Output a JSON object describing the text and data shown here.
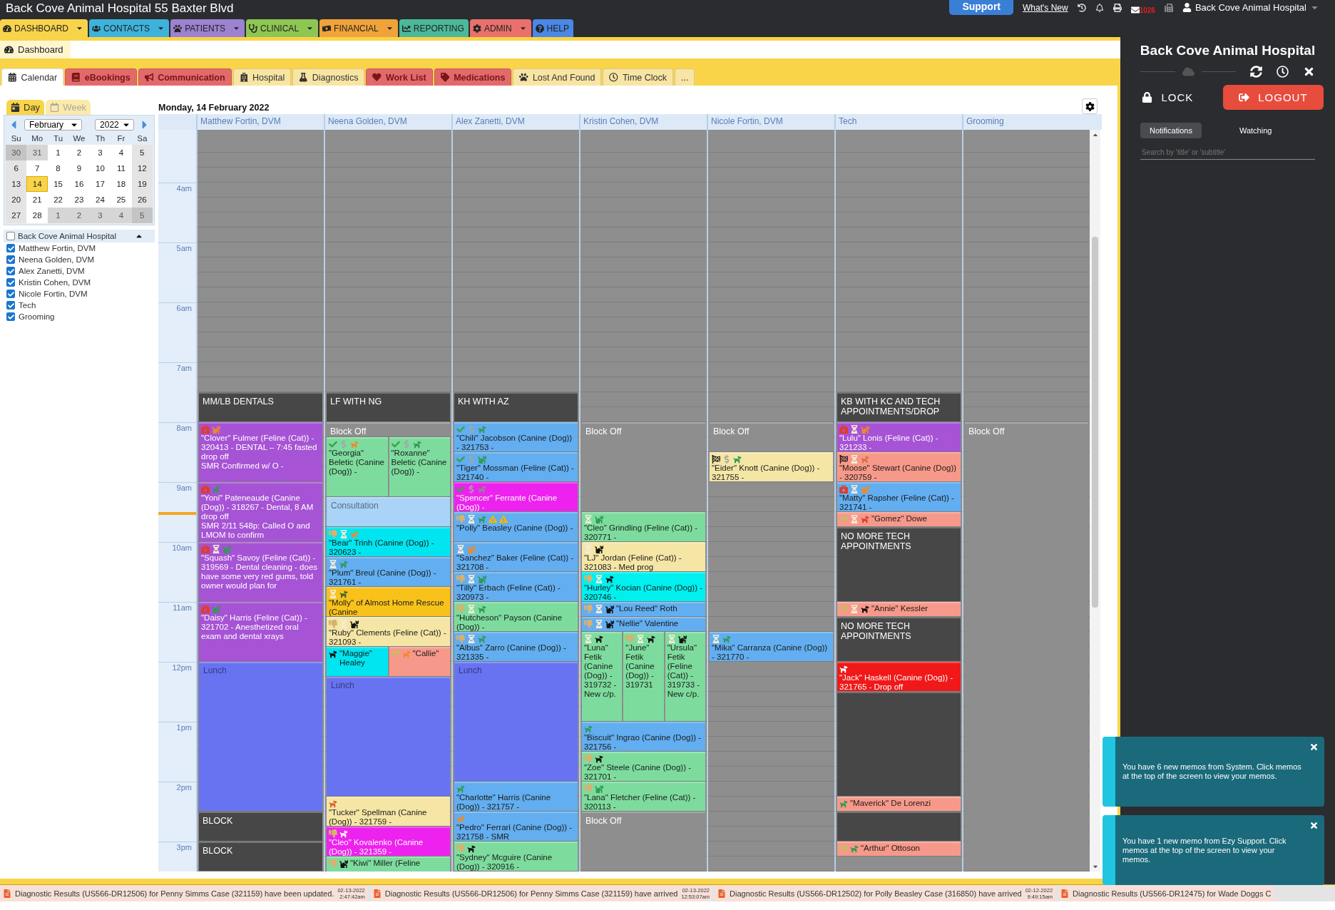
{
  "header": {
    "title": "Back Cove Animal Hospital 55 Baxter Blvd",
    "support": "Support",
    "whats_new": "What's New",
    "mail_count": "1026",
    "user": "Back Cove Animal Hospital"
  },
  "nav": [
    {
      "label": "DASHBOARD",
      "color": "#f8d44c",
      "menu": true
    },
    {
      "label": "CONTACTS",
      "color": "#3db3dc",
      "menu": true
    },
    {
      "label": "PATIENTS",
      "color": "#9c82d0",
      "menu": true
    },
    {
      "label": "CLINICAL",
      "color": "#8ec653",
      "menu": true
    },
    {
      "label": "FINANCIAL",
      "color": "#f0a33a",
      "menu": true
    },
    {
      "label": "REPORTING",
      "color": "#4cb89a",
      "menu": false
    },
    {
      "label": "ADMIN",
      "color": "#e9706c",
      "menu": true
    },
    {
      "label": "HELP",
      "color": "#4a87e6",
      "menu": false
    }
  ],
  "page_tab": "Dashboard",
  "tabs": [
    {
      "label": "Calendar",
      "selected": true
    },
    {
      "label": "eBookings",
      "color": "#e36a6a",
      "selected": false
    },
    {
      "label": "Communication",
      "color": "#e36a6a",
      "selected": false
    },
    {
      "label": "Hospital",
      "color": "#f8e5a3",
      "selected": false
    },
    {
      "label": "Diagnostics",
      "color": "#f8e5a3",
      "selected": false
    },
    {
      "label": "Work List",
      "color": "#e36a6a",
      "selected": false
    },
    {
      "label": "Medications",
      "color": "#e36a6a",
      "selected": false
    },
    {
      "label": "Lost And Found",
      "color": "#f8e5a3",
      "selected": false
    },
    {
      "label": "Time Clock",
      "color": "#f8e5a3",
      "selected": false
    },
    {
      "label": "...",
      "color": "#f8e5a3",
      "selected": false
    }
  ],
  "view_tabs": [
    {
      "label": "Day",
      "selected": true
    },
    {
      "label": "Week",
      "selected": false
    }
  ],
  "mini_calendar": {
    "month": "February",
    "year": "2022",
    "weekdays": [
      "Su",
      "Mo",
      "Tu",
      "We",
      "Th",
      "Fr",
      "Sa"
    ],
    "weeks": [
      [
        {
          "day": "30",
          "other_month": true,
          "selected": false
        },
        {
          "day": "31",
          "other_month": true,
          "selected": false
        },
        {
          "day": "1",
          "other_month": false,
          "selected": false
        },
        {
          "day": "2",
          "other_month": false,
          "selected": false
        },
        {
          "day": "3",
          "other_month": false,
          "selected": false
        },
        {
          "day": "4",
          "other_month": false,
          "selected": false
        },
        {
          "day": "5",
          "other_month": false,
          "selected": false
        }
      ],
      [
        {
          "day": "6",
          "other_month": false,
          "selected": false
        },
        {
          "day": "7",
          "other_month": false,
          "selected": false
        },
        {
          "day": "8",
          "other_month": false,
          "selected": false
        },
        {
          "day": "9",
          "other_month": false,
          "selected": false
        },
        {
          "day": "10",
          "other_month": false,
          "selected": false
        },
        {
          "day": "11",
          "other_month": false,
          "selected": false
        },
        {
          "day": "12",
          "other_month": false,
          "selected": false
        }
      ],
      [
        {
          "day": "13",
          "other_month": false,
          "selected": false
        },
        {
          "day": "14",
          "other_month": false,
          "selected": true
        },
        {
          "day": "15",
          "other_month": false,
          "selected": false
        },
        {
          "day": "16",
          "other_month": false,
          "selected": false
        },
        {
          "day": "17",
          "other_month": false,
          "selected": false
        },
        {
          "day": "18",
          "other_month": false,
          "selected": false
        },
        {
          "day": "19",
          "other_month": false,
          "selected": false
        }
      ],
      [
        {
          "day": "20",
          "other_month": false,
          "selected": false
        },
        {
          "day": "21",
          "other_month": false,
          "selected": false
        },
        {
          "day": "22",
          "other_month": false,
          "selected": false
        },
        {
          "day": "23",
          "other_month": false,
          "selected": false
        },
        {
          "day": "24",
          "other_month": false,
          "selected": false
        },
        {
          "day": "25",
          "other_month": false,
          "selected": false
        },
        {
          "day": "26",
          "other_month": false,
          "selected": false
        }
      ],
      [
        {
          "day": "27",
          "other_month": false,
          "selected": false
        },
        {
          "day": "28",
          "other_month": false,
          "selected": false
        },
        {
          "day": "1",
          "other_month": true,
          "selected": false
        },
        {
          "day": "2",
          "other_month": true,
          "selected": false
        },
        {
          "day": "3",
          "other_month": true,
          "selected": false
        },
        {
          "day": "4",
          "other_month": true,
          "selected": false
        },
        {
          "day": "5",
          "other_month": true,
          "selected": false
        }
      ]
    ]
  },
  "resources": {
    "group": {
      "label": "Back Cove Animal Hospital",
      "checked": false,
      "expanded": true
    },
    "items": [
      {
        "label": "Matthew Fortin, DVM",
        "checked": true
      },
      {
        "label": "Neena Golden, DVM",
        "checked": true
      },
      {
        "label": "Alex Zanetti, DVM",
        "checked": true
      },
      {
        "label": "Kristin Cohen, DVM",
        "checked": true
      },
      {
        "label": "Nicole Fortin, DVM",
        "checked": true
      },
      {
        "label": "Tech",
        "checked": true
      },
      {
        "label": "Grooming",
        "checked": true
      }
    ]
  },
  "calendar": {
    "date": "Monday, 14 February 2022",
    "hours": [
      "4am",
      "5am",
      "6am",
      "7am",
      "8am",
      "9am",
      "10am",
      "11am",
      "12pm",
      "1pm",
      "2pm",
      "3pm"
    ],
    "columns": [
      {
        "name": "Matthew Fortin, DVM",
        "events": [
          {
            "kind": "block",
            "text": "MM/LB DENTALS"
          },
          {
            "kind": "appointment",
            "color": "#a653d5",
            "icons": [
              {
                "kind": "medical"
              },
              {
                "kind": "cat",
                "color": "#f0882a"
              }
            ],
            "text": "\"Clover\" Fulmer (Feline (Cat)) - 320413 - DENTAL – 7:45 fasted drop off\nSMR Confirmed w/ O -"
          },
          {
            "kind": "appointment",
            "color": "#a653d5",
            "icons": [
              {
                "kind": "medical"
              },
              {
                "kind": "dog",
                "color": "#2f9a55"
              }
            ],
            "text": "\"Yoni\" Pateneaude (Canine (Dog)) - 318267 - Dental, 8 AM drop off\nSMR 2/11 548p: Called O and LMOM to confirm"
          },
          {
            "kind": "appointment",
            "color": "#a653d5",
            "icons": [
              {
                "kind": "medical"
              },
              {
                "kind": "hourglass"
              },
              {
                "kind": "cat",
                "color": "#2f9a55"
              }
            ],
            "text": "\"Squash\" Savoy (Feline (Cat)) - 319569 - Dental cleaning - does have some very red gums, told owner would plan for"
          },
          {
            "kind": "appointment",
            "color": "#a653d5",
            "icons": [
              {
                "kind": "medical"
              },
              {
                "kind": "cat",
                "color": "#2f9a55"
              }
            ],
            "text": "\"Daisy\" Harris (Feline (Cat)) - 321702 - Anesthetized oral exam and dental xrays"
          },
          {
            "kind": "reserved",
            "color": "#6873f2",
            "text": "Lunch"
          },
          {
            "kind": "block",
            "text": "BLOCK"
          },
          {
            "kind": "block",
            "text": "BLOCK"
          }
        ]
      },
      {
        "name": "Neena Golden, DVM",
        "events": [
          {
            "kind": "block",
            "text": "LF WITH NG"
          },
          {
            "kind": "blockoff",
            "text": "Block Off"
          },
          {
            "kind": "split",
            "parts": [
              {
                "color": "#7ddc9d",
                "icons": [
                  {
                    "kind": "check"
                  },
                  {
                    "kind": "dollar"
                  },
                  {
                    "kind": "dog",
                    "color": "#f0882a"
                  }
                ],
                "text": "\"Georgia\" Beletic (Canine (Dog)) -"
              },
              {
                "color": "#7ddc9d",
                "icons": [
                  {
                    "kind": "check"
                  },
                  {
                    "kind": "dollar"
                  },
                  {
                    "kind": "dog",
                    "color": "#2f9a55"
                  }
                ],
                "text": "\"Roxanne\" Beletic (Canine (Dog)) -"
              }
            ]
          },
          {
            "kind": "reserved",
            "color": "#a9d3f7",
            "text": "Consultation"
          },
          {
            "kind": "appointment",
            "color": "#00e5f0",
            "icons": [
              {
                "kind": "thumb"
              },
              {
                "kind": "hourglass"
              },
              {
                "kind": "dog",
                "color": "#f0882a"
              }
            ],
            "text": "\"Bear\" Trinh (Canine (Dog)) - 320623 -"
          },
          {
            "kind": "appointment",
            "color": "#62aef0",
            "icons": [
              {
                "kind": "hourglass"
              },
              {
                "kind": "dog",
                "color": "#2f9a55"
              }
            ],
            "text": "\"Plum\" Breul (Canine (Dog)) - 321761 -"
          },
          {
            "kind": "appointment",
            "color": "#f9c21a",
            "icons": [
              {
                "kind": "hourglass"
              },
              {
                "kind": "dog",
                "color": "#3d6b2a"
              }
            ],
            "text": "\"Molly\" of Almost Home Rescue (Canine"
          },
          {
            "kind": "appointment",
            "color": "#f5e6a6",
            "icons": [
              {
                "kind": "thumb"
              },
              {
                "kind": "hourglass"
              },
              {
                "kind": "cat",
                "color": "#111111"
              }
            ],
            "text": "\"Ruby\" Clements (Feline (Cat)) - 321093 -"
          },
          {
            "kind": "split",
            "parts": [
              {
                "color": "#00e5f0",
                "icons": [
                  {
                    "kind": "dog",
                    "color": "#111111"
                  }
                ],
                "text": "\"Maggie\" Healey"
              },
              {
                "color": "#f7998a",
                "icons": [
                  {
                    "kind": "thumb"
                  },
                  {
                    "kind": "dog",
                    "color": "#f0882a"
                  }
                ],
                "text": "\"Callie\""
              }
            ]
          },
          {
            "kind": "reserved",
            "color": "#6873f2",
            "text": "Lunch"
          },
          {
            "kind": "appointment",
            "color": "#f5e6a6",
            "icons": [
              {
                "kind": "dog",
                "color": "#e0602b"
              }
            ],
            "text": "\"Tucker\" Spellman (Canine (Dog)) - 321759 -"
          },
          {
            "kind": "appointment",
            "color": "#ee22ee",
            "icons": [
              {
                "kind": "thumb"
              },
              {
                "kind": "dog",
                "color": "#ffffff"
              }
            ],
            "text": "\"Cleo\" Kovalenko (Canine (Dog)) - 321359 -"
          },
          {
            "kind": "appointment",
            "color": "#7ddc9d",
            "icons": [
              {
                "kind": "thumb"
              },
              {
                "kind": "cat",
                "color": "#111111"
              }
            ],
            "text": "\"Kiwi\" Miller (Feline"
          }
        ]
      },
      {
        "name": "Alex Zanetti, DVM",
        "events": [
          {
            "kind": "block",
            "text": "KH WITH AZ"
          },
          {
            "kind": "appointment",
            "color": "#62aef0",
            "icons": [
              {
                "kind": "check"
              },
              {
                "kind": "dollar"
              },
              {
                "kind": "dog",
                "color": "#2f9a55"
              }
            ],
            "text": "\"Chili\" Jacobson (Canine (Dog)) - 321753 -"
          },
          {
            "kind": "appointment",
            "color": "#62aef0",
            "icons": [
              {
                "kind": "check"
              },
              {
                "kind": "dollar"
              },
              {
                "kind": "cat",
                "color": "#2f9a55"
              }
            ],
            "text": "\"Tiger\" Mossman (Feline (Cat)) - 321740 -"
          },
          {
            "kind": "appointment",
            "color": "#ee22ee",
            "icons": [
              {
                "kind": "check"
              },
              {
                "kind": "dollar"
              },
              {
                "kind": "dog",
                "color": "#8a8a8a"
              }
            ],
            "text": "\"Spencer\" Ferrante (Canine (Dog)) -"
          },
          {
            "kind": "appointment",
            "color": "#62aef0",
            "icons": [
              {
                "kind": "thumb"
              },
              {
                "kind": "hourglass"
              },
              {
                "kind": "dog",
                "color": "#2f9a55"
              },
              {
                "kind": "warning"
              },
              {
                "kind": "warning"
              }
            ],
            "text": "\"Polly\" Beasley (Canine (Dog)) -"
          },
          {
            "kind": "appointment",
            "color": "#62aef0",
            "icons": [
              {
                "kind": "hourglass"
              },
              {
                "kind": "cat",
                "color": "#f0882a"
              }
            ],
            "text": "\"Sanchez\" Baker (Feline (Cat)) - 321708 -"
          },
          {
            "kind": "appointment",
            "color": "#62aef0",
            "icons": [
              {
                "kind": "thumb"
              },
              {
                "kind": "hourglass"
              },
              {
                "kind": "cat",
                "color": "#2f9a55"
              }
            ],
            "text": "\"Tilly\" Erbach (Feline (Cat)) - 320973 -"
          },
          {
            "kind": "appointment",
            "color": "#7ddc9d",
            "icons": [
              {
                "kind": "thumb"
              },
              {
                "kind": "hourglass"
              },
              {
                "kind": "dog",
                "color": "#2f9a55"
              }
            ],
            "text": "\"Hutcheson\" Payson (Canine (Dog)) -"
          },
          {
            "kind": "appointment",
            "color": "#62aef0",
            "icons": [
              {
                "kind": "thumb"
              },
              {
                "kind": "hourglass"
              },
              {
                "kind": "dog",
                "color": "#2f9a55"
              }
            ],
            "text": "\"Albus\" Zarro (Canine (Dog)) - 321335 -"
          },
          {
            "kind": "reserved",
            "color": "#6873f2",
            "text": "Lunch"
          },
          {
            "kind": "appointment",
            "color": "#62aef0",
            "icons": [
              {
                "kind": "dog",
                "color": "#2f9a55"
              }
            ],
            "text": "\"Charlotte\" Harris (Canine (Dog)) - 321757 -"
          },
          {
            "kind": "appointment",
            "color": "#62aef0",
            "icons": [
              {
                "kind": "dog",
                "color": "#f0882a"
              }
            ],
            "text": "\"Pedro\" Ferrari (Canine (Dog)) - 321758 - SMR"
          },
          {
            "kind": "appointment",
            "color": "#7ddc9d",
            "icons": [
              {
                "kind": "thumb"
              },
              {
                "kind": "dog",
                "color": "#111111"
              }
            ],
            "text": "\"Sydney\" Mcguire (Canine (Dog)) - 320916 -"
          }
        ]
      },
      {
        "name": "Kristin Cohen, DVM",
        "events": [
          {
            "kind": "blockoff",
            "text": "Block Off"
          },
          {
            "kind": "appointment",
            "color": "#7ddc9d",
            "icons": [
              {
                "kind": "hourglass"
              },
              {
                "kind": "cat",
                "color": "#2f9a55"
              }
            ],
            "text": "\"Cleo\" Grindling (Feline (Cat)) - 320771 -"
          },
          {
            "kind": "appointment",
            "color": "#f5e6a6",
            "icons": [
              {
                "kind": "hourglass"
              },
              {
                "kind": "cat",
                "color": "#111111"
              }
            ],
            "text": "\"LJ\" Jordan (Feline (Cat)) - 321083 - Med prog"
          },
          {
            "kind": "appointment",
            "color": "#00f0f0",
            "icons": [
              {
                "kind": "thumb"
              },
              {
                "kind": "hourglass"
              },
              {
                "kind": "dog",
                "color": "#111111"
              }
            ],
            "text": "\"Hurley\" Kocian (Canine (Dog)) - 320746 -"
          },
          {
            "kind": "appointment",
            "color": "#62aef0",
            "icons": [
              {
                "kind": "thumb"
              },
              {
                "kind": "hourglass"
              },
              {
                "kind": "cat",
                "color": "#111111"
              }
            ],
            "text": "\"Lou Reed\" Roth"
          },
          {
            "kind": "appointment",
            "color": "#62aef0",
            "icons": [
              {
                "kind": "thumb"
              },
              {
                "kind": "hourglass"
              },
              {
                "kind": "cat",
                "color": "#111111"
              }
            ],
            "text": "\"Nellie\" Valentine"
          },
          {
            "kind": "split",
            "parts": [
              {
                "color": "#7ddc9d",
                "icons": [
                  {
                    "kind": "hourglass"
                  },
                  {
                    "kind": "dog",
                    "color": "#111111"
                  }
                ],
                "text": "\"Luna\" Fetik (Canine (Dog)) - 319732 - New c/p."
              },
              {
                "color": "#7ddc9d",
                "icons": [
                  {
                    "kind": "thumb"
                  },
                  {
                    "kind": "hourglass"
                  },
                  {
                    "kind": "dog",
                    "color": "#111111"
                  }
                ],
                "text": "\"June\" Fetik (Canine (Dog)) - 319731"
              },
              {
                "color": "#7ddc9d",
                "icons": [
                  {
                    "kind": "hourglass"
                  },
                  {
                    "kind": "cat",
                    "color": "#111111"
                  }
                ],
                "text": "\"Ursula\" Fetik (Feline (Cat)) - 319733 - New c/p."
              }
            ]
          },
          {
            "kind": "appointment",
            "color": "#62aef0",
            "icons": [
              {
                "kind": "dog",
                "color": "#2f9a55"
              }
            ],
            "text": "\"Biscuit\" Ingrao (Canine (Dog)) - 321756 -"
          },
          {
            "kind": "appointment",
            "color": "#7ddc9d",
            "icons": [
              {
                "kind": "thumb"
              },
              {
                "kind": "dog",
                "color": "#111111"
              }
            ],
            "text": "\"Zoe\" Steele (Canine (Dog)) - 321701 -"
          },
          {
            "kind": "appointment",
            "color": "#7ddc9d",
            "icons": [
              {
                "kind": "thumb"
              },
              {
                "kind": "cat",
                "color": "#2f9a55"
              }
            ],
            "text": "\"Lana\" Fletcher (Feline (Cat)) - 320113 -"
          },
          {
            "kind": "blockoff",
            "text": "Block Off"
          }
        ]
      },
      {
        "name": "Nicole Fortin, DVM",
        "events": [
          {
            "kind": "blockoff",
            "text": "Block Off"
          },
          {
            "kind": "appointment",
            "color": "#f5e6a6",
            "icons": [
              {
                "kind": "checkered"
              },
              {
                "kind": "dollar"
              },
              {
                "kind": "dog",
                "color": "#2f9a55"
              }
            ],
            "text": "\"Eider\" Knott (Canine (Dog)) - 321755 -"
          },
          {
            "kind": "appointment",
            "color": "#62aef0",
            "icons": [
              {
                "kind": "hourglass"
              },
              {
                "kind": "dog",
                "color": "#2f9a55"
              }
            ],
            "text": "\"Mika\" Carranza (Canine (Dog)) - 321770 -"
          }
        ]
      },
      {
        "name": "Tech",
        "events": [
          {
            "kind": "block",
            "text": "KB WITH KC AND TECH APPOINTMENTS/DROP"
          },
          {
            "kind": "appointment",
            "color": "#a653d5",
            "icons": [
              {
                "kind": "medical"
              },
              {
                "kind": "hourglass"
              },
              {
                "kind": "cat",
                "color": "#f0882a"
              }
            ],
            "text": "\"Lulu\" Lonis (Feline (Cat)) - 321233 -"
          },
          {
            "kind": "appointment",
            "color": "#f7998a",
            "icons": [
              {
                "kind": "checkered"
              },
              {
                "kind": "hourglass"
              },
              {
                "kind": "dog",
                "color": "#d9703a"
              }
            ],
            "text": "\"Moose\" Stewart (Canine (Dog)) - 320759 -"
          },
          {
            "kind": "appointment",
            "color": "#62aef0",
            "icons": [
              {
                "kind": "medical"
              },
              {
                "kind": "hourglass"
              },
              {
                "kind": "cat",
                "color": "#f0882a"
              }
            ],
            "text": "\"Matty\" Rapsher (Feline (Cat)) - 321741 -"
          },
          {
            "kind": "appointment",
            "color": "#f7998a",
            "icons": [
              {
                "kind": "thumb"
              },
              {
                "kind": "hourglass"
              },
              {
                "kind": "dog",
                "color": "#e23b2b"
              }
            ],
            "text": "\"Gomez\" Dowe"
          },
          {
            "kind": "block",
            "text": "NO MORE TECH APPOINTMENTS"
          },
          {
            "kind": "appointment",
            "color": "#f7998a",
            "icons": [
              {
                "kind": "thumb"
              },
              {
                "kind": "hourglass"
              },
              {
                "kind": "dog",
                "color": "#111111"
              }
            ],
            "text": "\"Annie\" Kessler"
          },
          {
            "kind": "block",
            "text": "NO MORE TECH APPOINTMENTS"
          },
          {
            "kind": "appointment",
            "color": "#f01818",
            "icons": [
              {
                "kind": "dog",
                "color": "#ffffff"
              }
            ],
            "text": "\"Jack\" Haskell (Canine (Dog)) - 321765 - Drop off"
          },
          {
            "kind": "block"
          },
          {
            "kind": "appointment",
            "color": "#f7998a",
            "icons": [
              {
                "kind": "dog",
                "color": "#2f9a55"
              }
            ],
            "text": "\"Maverick\" De Lorenzi"
          },
          {
            "kind": "block"
          },
          {
            "kind": "appointment",
            "color": "#f7998a",
            "icons": [
              {
                "kind": "thumb"
              },
              {
                "kind": "dog",
                "color": "#2f9a55"
              }
            ],
            "text": "\"Arthur\" Ottoson"
          }
        ]
      },
      {
        "name": "Grooming",
        "events": [
          {
            "kind": "blockoff",
            "text": "Block Off"
          }
        ]
      }
    ]
  },
  "side_panel": {
    "title": "Back Cove Animal Hospital",
    "lock": "LOCK",
    "logout": "LOGOUT",
    "tabs": [
      {
        "label": "Notifications",
        "selected": true
      },
      {
        "label": "Watching",
        "selected": false
      }
    ],
    "search": {
      "placeholder": "Search by 'title' or 'subtitle'"
    }
  },
  "toasts": [
    "You have 6 new memos from System. Click memos at the top of the screen to view your memos.",
    "You have 1 new memo from Ezy Support. Click memos at the top of the screen to view your memos."
  ],
  "ticker": [
    {
      "text": "Diagnostic Results (US566-DR12506) for Penny Simms Case (321159) have been updated.",
      "date": "02-13-2022",
      "time": "2:47:42am"
    },
    {
      "text": "Diagnostic Results (US566-DR12506) for Penny Simms Case (321159) have arrived",
      "date": "02-13-2022",
      "time": "12:53:07am"
    },
    {
      "text": "Diagnostic Results (US566-DR12502) for Polly Beasley Case (316850) have arrived",
      "date": "02-12-2022",
      "time": "9:49:15am"
    },
    {
      "text": "Diagnostic Results (US566-DR12475) for Wade Doggs C"
    }
  ]
}
